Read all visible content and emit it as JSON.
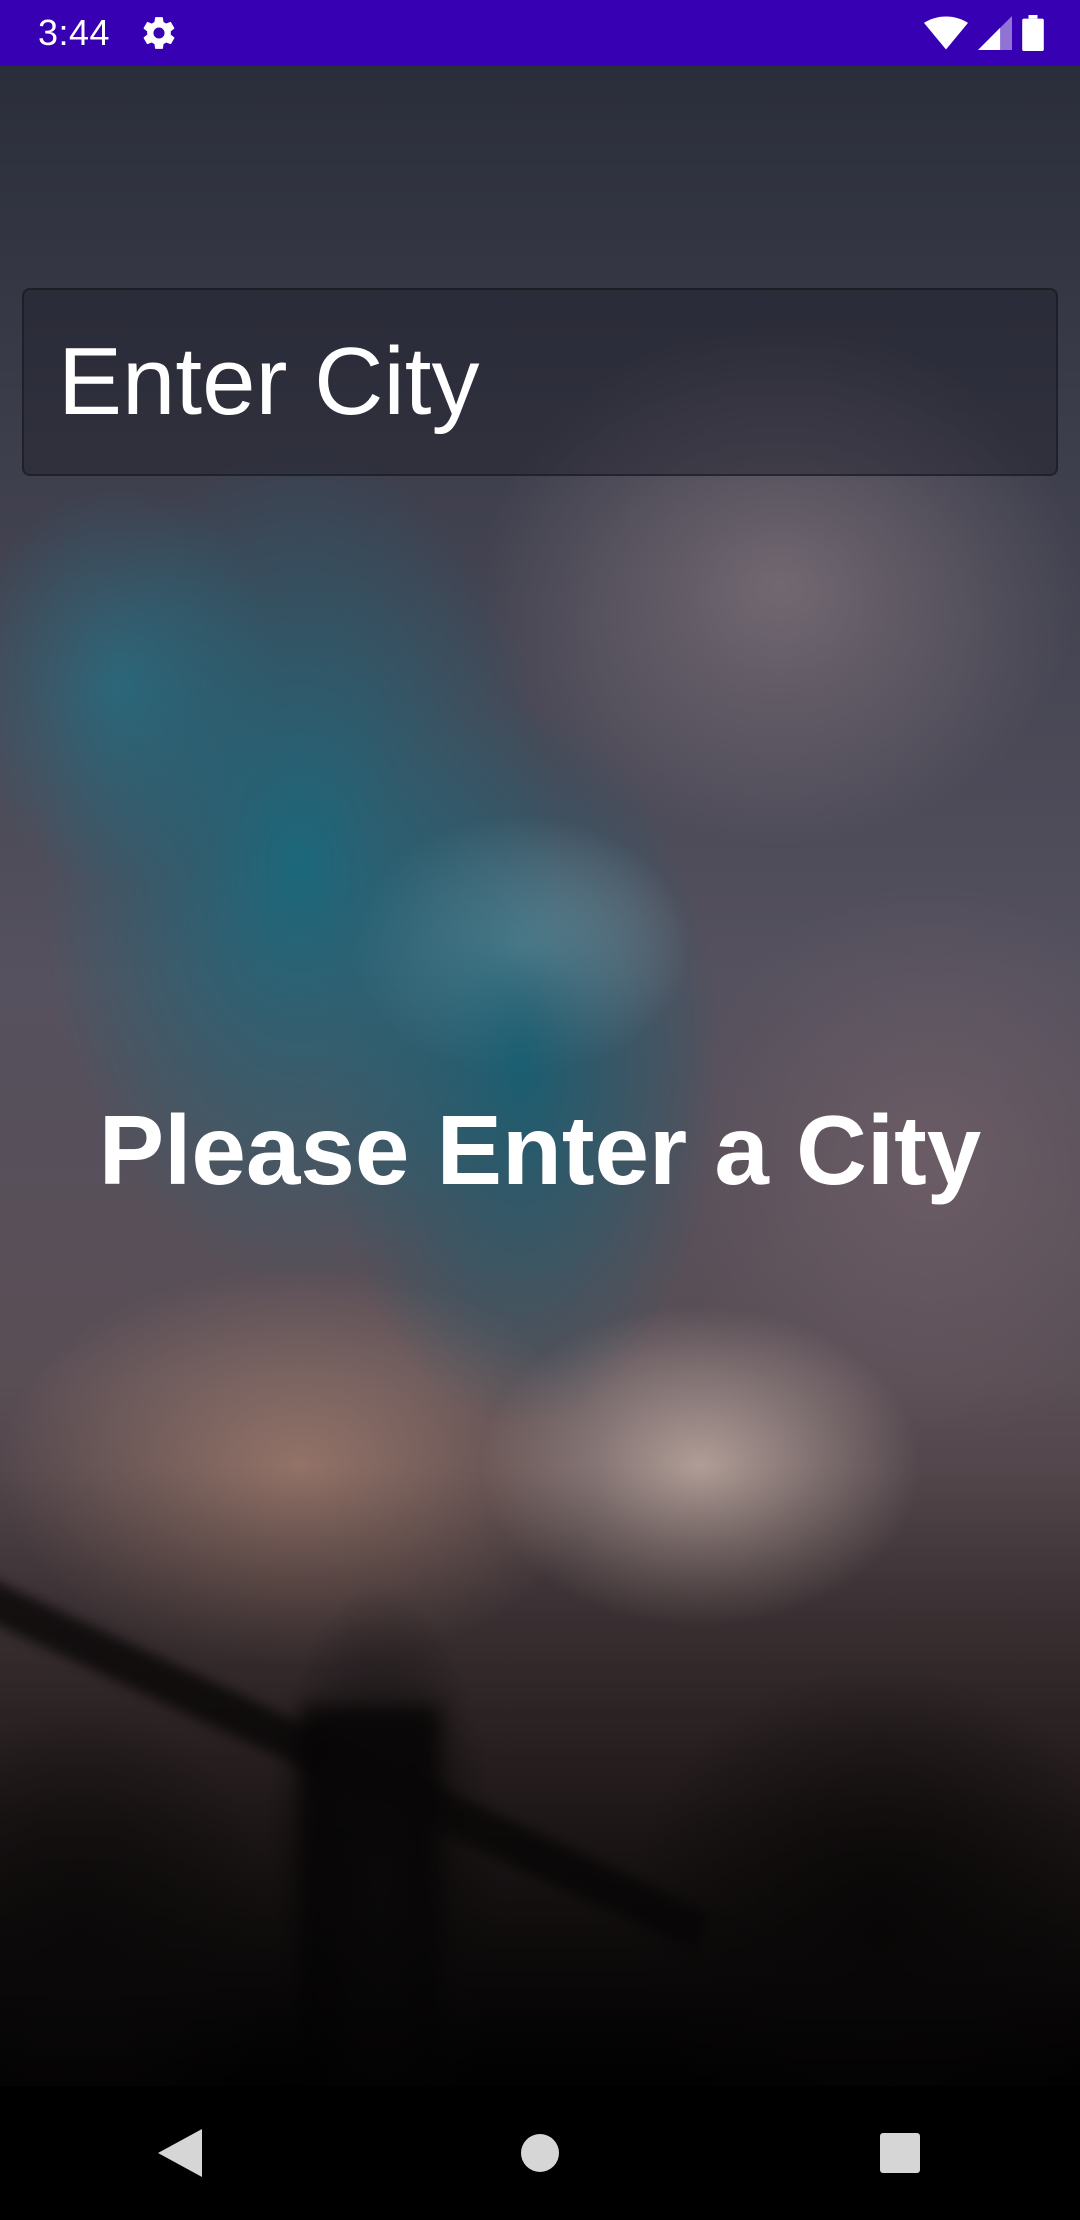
{
  "status_bar": {
    "time": "3:44",
    "icons": [
      "gear-icon",
      "wifi-icon",
      "signal-icon",
      "battery-icon"
    ],
    "background_color": "#3700b3"
  },
  "search": {
    "placeholder": "Enter City",
    "value": ""
  },
  "main": {
    "message": "Please Enter a City"
  },
  "nav_bar": {
    "buttons": [
      "back-icon",
      "home-icon",
      "recents-icon"
    ]
  }
}
